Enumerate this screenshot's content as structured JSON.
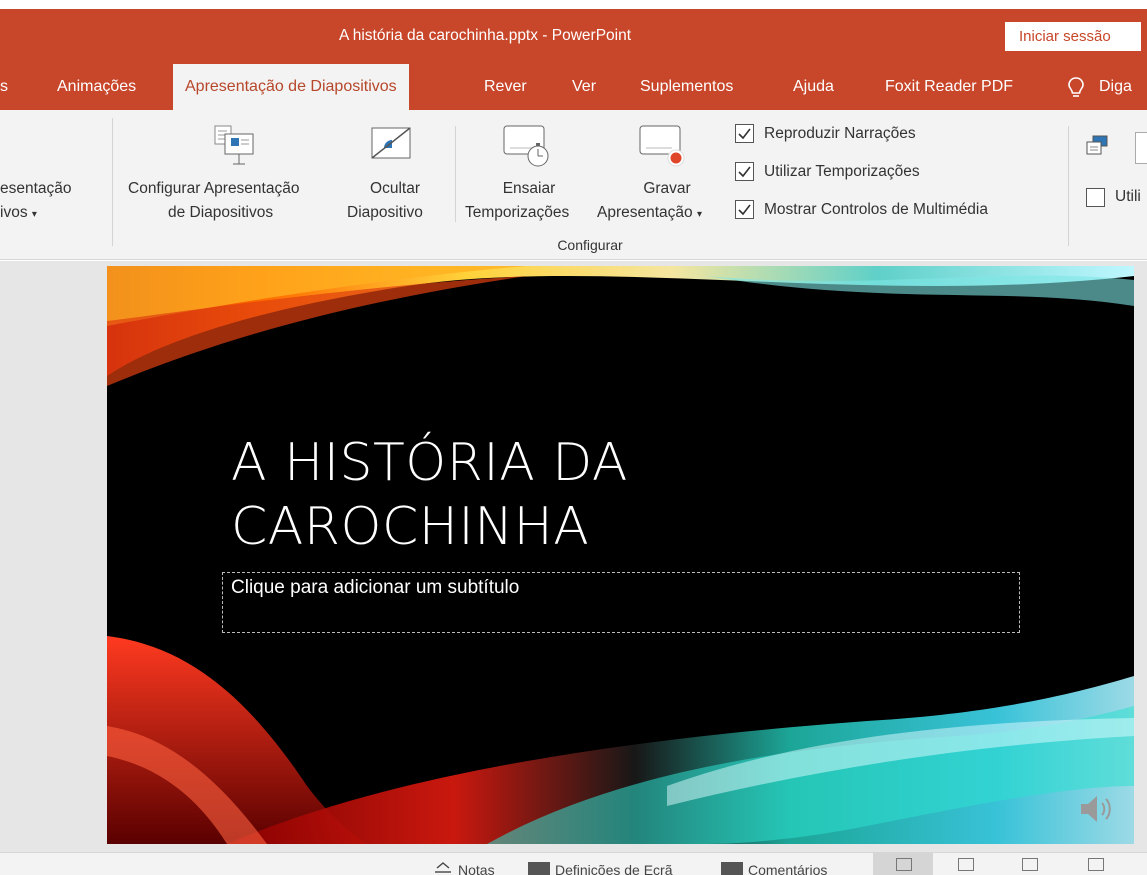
{
  "window": {
    "title": "A história da carochinha.pptx  -  PowerPoint",
    "signin_label": "Iniciar sessão"
  },
  "tabs": [
    {
      "label": "Animações"
    },
    {
      "label": "Apresentação de Diapositivos",
      "active": true
    },
    {
      "label": "Rever"
    },
    {
      "label": "Ver"
    },
    {
      "label": "Suplementos"
    },
    {
      "label": "Ajuda"
    },
    {
      "label": "Foxit Reader PDF"
    },
    {
      "label": "Diga"
    }
  ],
  "ribbon": {
    "custom_show_line1": "esentação",
    "custom_show_line2": "ivos",
    "setup_slideshow_line1": "Configurar Apresentação",
    "setup_slideshow_line2": "de Diapositivos",
    "hide_slide_line1": "Ocultar",
    "hide_slide_line2": "Diapositivo",
    "rehearse_line1": "Ensaiar",
    "rehearse_line2": "Temporizações",
    "record_line1": "Gravar",
    "record_line2": "Apresentação",
    "group_label": "Configurar",
    "checkboxes": [
      {
        "label": "Reproduzir Narrações",
        "checked": true
      },
      {
        "label": "Utilizar Temporizações",
        "checked": true
      },
      {
        "label": "Mostrar Controlos de Multimédia",
        "checked": true
      }
    ],
    "presenter_label": "Utili"
  },
  "slide": {
    "title_line1": "A HISTÓRIA DA",
    "title_line2": "CAROCHINHA",
    "subtitle_placeholder": "Clique para adicionar um subtítulo"
  },
  "statusbar": {
    "notes": "Notas",
    "display_settings": "Definições de Ecrã",
    "comments": "Comentários"
  },
  "colors": {
    "accent": "#c8462a",
    "ribbon_bg": "#f3f3f3"
  }
}
